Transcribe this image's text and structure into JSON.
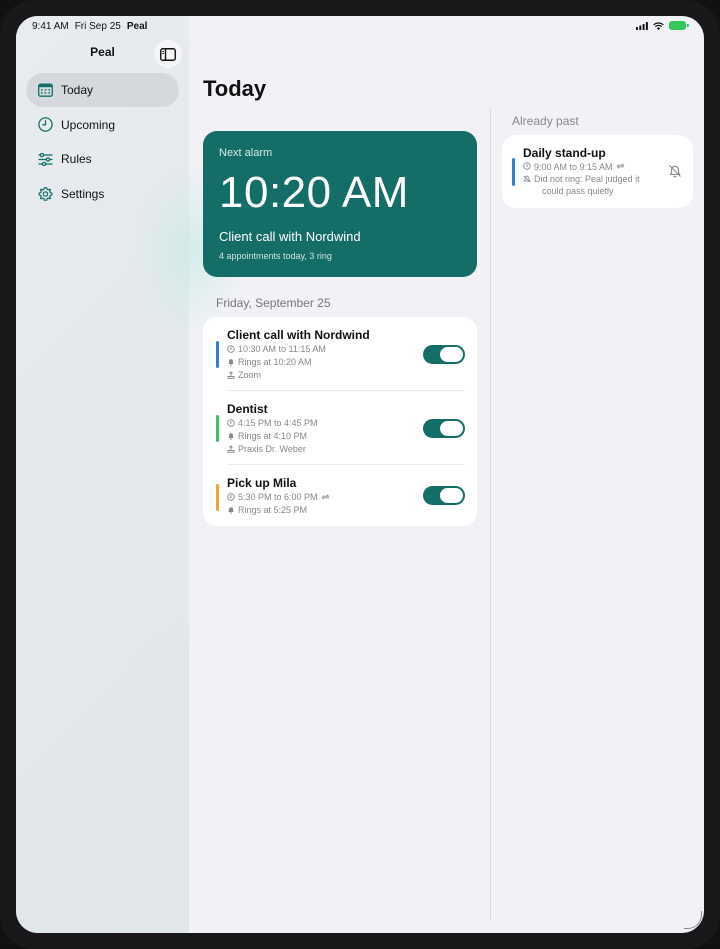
{
  "status_bar": {
    "time": "9:41 AM",
    "date": "Fri Sep 25",
    "app": "Peal"
  },
  "sidebar": {
    "title": "Peal",
    "toggle_icon": "sidebar-icon",
    "items": [
      {
        "label": "Today",
        "icon": "calendar-icon",
        "active": true
      },
      {
        "label": "Upcoming",
        "icon": "clock-icon",
        "active": false
      },
      {
        "label": "Rules",
        "icon": "sliders-icon",
        "active": false
      },
      {
        "label": "Settings",
        "icon": "gear-icon",
        "active": false
      }
    ]
  },
  "main": {
    "title": "Today",
    "next_alarm": {
      "label": "Next alarm",
      "time": "10:20 AM",
      "event": "Client call with Nordwind",
      "summary": "4 appointments today, 3 ring"
    },
    "section_header": "Friday, September 25",
    "appointments": [
      {
        "title": "Client call with Nordwind",
        "time": "10:30 AM to 11:15 AM",
        "ring": "Rings at 10:20 AM",
        "location": "Zoom",
        "color": "#2f7fd6",
        "enabled": true,
        "repeats": false
      },
      {
        "title": "Dentist",
        "time": "4:15 PM to 4:45 PM",
        "ring": "Rings at 4:10 PM",
        "location": "Praxis Dr. Weber",
        "color": "#3cc26a",
        "enabled": true,
        "repeats": false
      },
      {
        "title": "Pick up Mila",
        "time": "5:30 PM to 6:00 PM",
        "ring": "Rings at 5:25 PM",
        "location": "",
        "color": "#f0a03c",
        "enabled": true,
        "repeats": true
      }
    ]
  },
  "past": {
    "header": "Already past",
    "items": [
      {
        "title": "Daily stand-up",
        "time": "9:00 AM to 9:15 AM",
        "note_line1": "Did not ring: Peal judged it",
        "note_line2": "could pass quietly",
        "color": "#2f7fd6",
        "repeats": true
      }
    ]
  },
  "colors": {
    "accent": "#146e67",
    "background": "#f1f1f6"
  }
}
